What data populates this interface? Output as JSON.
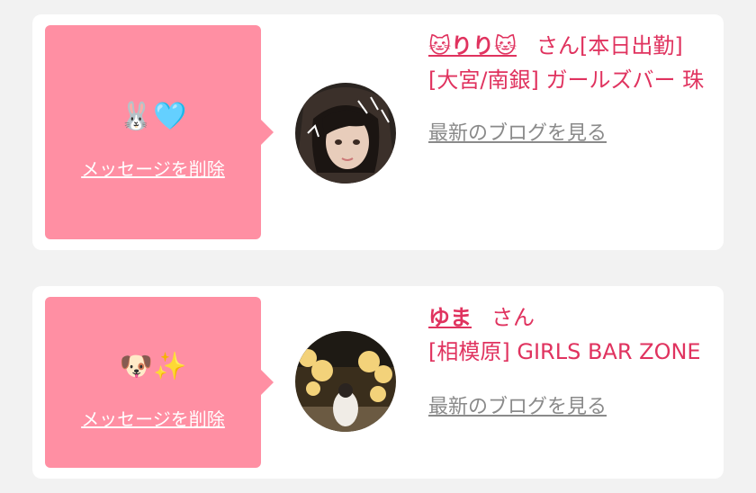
{
  "messages": [
    {
      "emoji": "🐰🩵",
      "delete_label": "メッセージを削除",
      "avatar_icon": "girl-portrait-photo",
      "name": "🐱りり🐱",
      "honorific": "さん",
      "status": "[本日出勤]",
      "shop_area": "[大宮/南銀] ガールズバー 珠",
      "blog_link": "最新のブログを見る"
    },
    {
      "emoji": "🐶✨",
      "delete_label": "メッセージを削除",
      "avatar_icon": "night-illumination-photo",
      "name": "ゆま",
      "honorific": "さん",
      "status": "",
      "shop_area": "[相模原] GIRLS BAR ZONE",
      "blog_link": "最新のブログを見る"
    }
  ],
  "colors": {
    "page_bg": "#f2f2f2",
    "card_bg": "#ffffff",
    "bubble_bg": "#ff8fa3",
    "accent_text": "#e0335f",
    "link_gray": "#8a8a8a"
  }
}
